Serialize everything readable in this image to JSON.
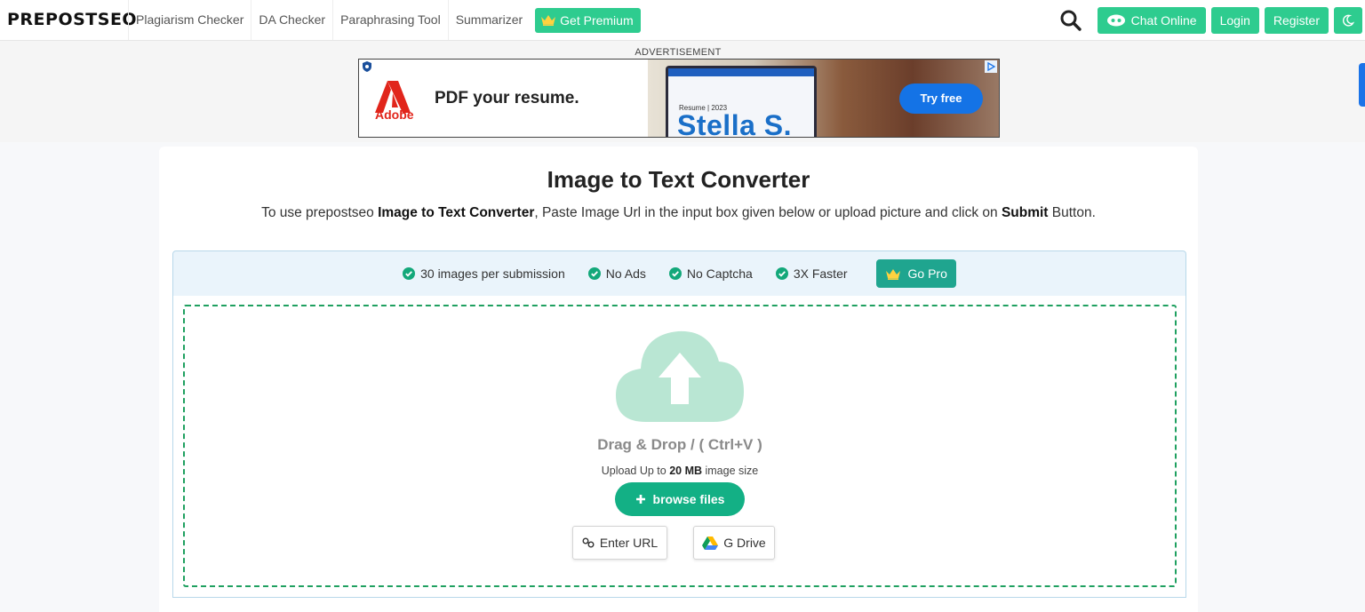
{
  "nav": {
    "logo": "PREPOSTSEO",
    "links": [
      "Plagiarism Checker",
      "DA Checker",
      "Paraphrasing Tool",
      "Summarizer"
    ],
    "premium": "Get Premium",
    "chat": "Chat Online",
    "login": "Login",
    "register": "Register"
  },
  "ad": {
    "label": "ADVERTISEMENT",
    "brand": "Adobe",
    "headline": "PDF your resume.",
    "screen_title": "Resume | 2023",
    "screen_name": "Stella S.",
    "cta": "Try free"
  },
  "main": {
    "title": "Image to Text Converter",
    "subtitle_parts": [
      "To use prepostseo ",
      "Image to Text Converter",
      ", Paste Image Url in the input box given below or upload picture and click on ",
      "Submit",
      " Button."
    ],
    "features": [
      "30 images per submission",
      "No Ads",
      "No Captcha",
      "3X Faster"
    ],
    "gopro": "Go Pro",
    "drag_drop": "Drag & Drop / ( Ctrl+V )",
    "upload_parts": [
      "Upload Up to ",
      "20 MB",
      " image size"
    ],
    "browse": "browse files",
    "enter_url": "Enter URL",
    "gdrive": "G Drive"
  },
  "colors": {
    "accent_green": "#2ecc8f",
    "browse_green": "#13b085",
    "gopro_teal": "#1fa58f",
    "dash_green": "#1fa060",
    "cloud": "#b9e6d3"
  }
}
